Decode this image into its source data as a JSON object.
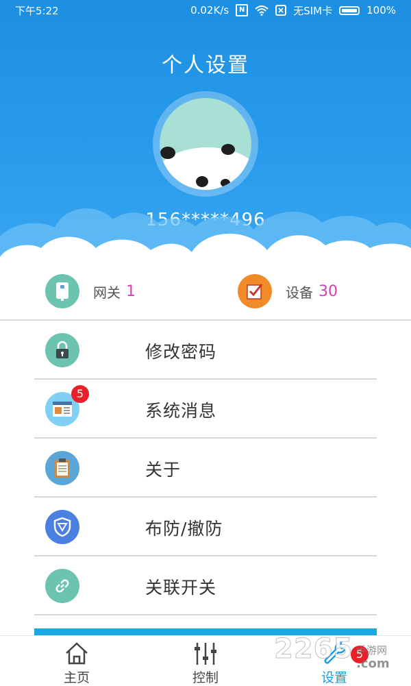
{
  "status_bar": {
    "time": "下午5:22",
    "speed": "0.02K/s",
    "nfc": "N",
    "sim": "无SIM卡",
    "battery": "100%",
    "icons": [
      "nfc-icon",
      "wifi-icon",
      "sim-icon",
      "battery-icon"
    ]
  },
  "header": {
    "title": "个人设置",
    "phone": "156*****496",
    "color_top": "#1c8fe3",
    "color_bottom": "#3aa8f2"
  },
  "stats": [
    {
      "label": "网关",
      "value": "1",
      "icon": "gateway-icon",
      "color": "#6cc3b0"
    },
    {
      "label": "设备",
      "value": "30",
      "icon": "checkbox-icon",
      "color": "#f08b28"
    }
  ],
  "menu": [
    {
      "label": "修改密码",
      "icon": "lock-icon",
      "color": "#6cc3b0"
    },
    {
      "label": "系统消息",
      "icon": "message-icon",
      "color": "#7fd0f2",
      "badge": "5"
    },
    {
      "label": "关于",
      "icon": "clipboard-icon",
      "color": "#5aa6d6"
    },
    {
      "label": "布防/撤防",
      "icon": "shield-icon",
      "color": "#4b7fe0"
    },
    {
      "label": "关联开关",
      "icon": "link-icon",
      "color": "#6cc3b0"
    }
  ],
  "tabbar": {
    "tabs": [
      {
        "label": "主页",
        "icon": "home-icon"
      },
      {
        "label": "控制",
        "icon": "sliders-icon"
      },
      {
        "label": "设置",
        "icon": "wrench-icon",
        "badge": "5",
        "active": true
      }
    ],
    "active_color": "#1a9be8"
  },
  "watermark": {
    "number": "2265",
    "text": "手游网",
    "domain": ".com"
  }
}
